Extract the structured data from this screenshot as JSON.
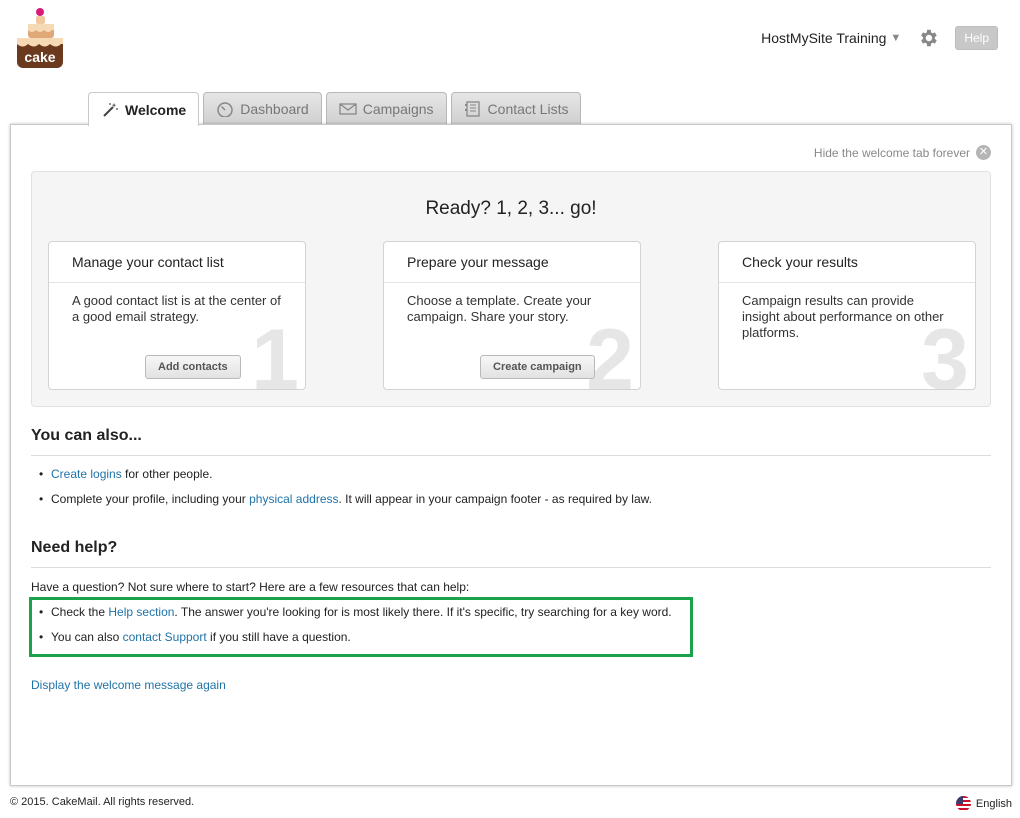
{
  "header": {
    "logo_text": "cake",
    "account_name": "HostMySite Training",
    "help_label": "Help"
  },
  "tabs": [
    {
      "label": "Welcome",
      "active": true
    },
    {
      "label": "Dashboard",
      "active": false
    },
    {
      "label": "Campaigns",
      "active": false
    },
    {
      "label": "Contact Lists",
      "active": false
    }
  ],
  "welcome": {
    "hide_label": "Hide the welcome tab forever",
    "ready_title": "Ready? 1, 2, 3... go!",
    "cards": [
      {
        "title": "Manage your contact list",
        "body": "A good contact list is at the center of a good email strategy.",
        "button": "Add contacts",
        "number": "1"
      },
      {
        "title": "Prepare your message",
        "body": "Choose a template. Create your campaign. Share your story.",
        "button": "Create campaign",
        "number": "2"
      },
      {
        "title": "Check your results",
        "body": "Campaign results can provide insight about performance on other platforms.",
        "button": "",
        "number": "3"
      }
    ]
  },
  "also": {
    "title": "You can also...",
    "item1_link": "Create logins",
    "item1_text": " for other people.",
    "item2_pre": "Complete your profile, including your ",
    "item2_link": "physical address",
    "item2_post": ". It will appear in your campaign footer - as required by law."
  },
  "help": {
    "title": "Need help?",
    "intro": "Have a question? Not sure where to start? Here are a few resources that can help:",
    "item1_pre": "Check the ",
    "item1_link": "Help section",
    "item1_post": ". The answer you're looking for is most likely there. If it's specific, try searching for a key word.",
    "item2_pre": "You can also ",
    "item2_link": "contact Support",
    "item2_post": " if you still have a question.",
    "again_link": "Display the welcome message again"
  },
  "footer": {
    "copyright": "© 2015. CakeMail. All rights reserved.",
    "language": "English"
  },
  "colors": {
    "link": "#1f73a8",
    "highlight_border": "#1aa34a",
    "logo_brown": "#6b3a1e"
  }
}
